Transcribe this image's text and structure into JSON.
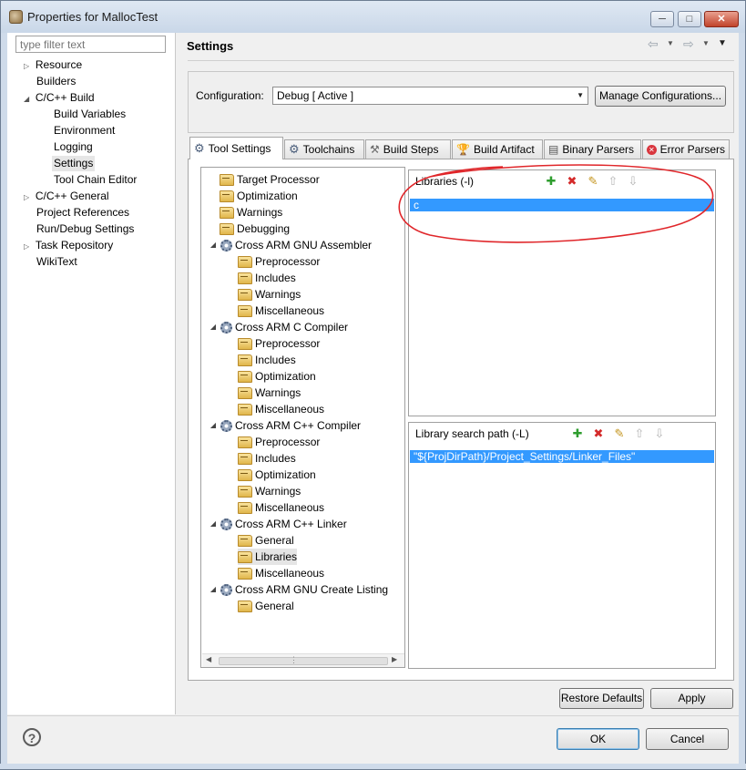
{
  "window": {
    "title": "Properties for MallocTest",
    "controls": {
      "minimize": "─",
      "maximize": "□",
      "close": "✕"
    }
  },
  "filter": {
    "placeholder": "type filter text"
  },
  "nav": {
    "items": [
      {
        "label": "Resource",
        "expandable": true,
        "expanded": false
      },
      {
        "label": "Builders"
      },
      {
        "label": "C/C++ Build",
        "expandable": true,
        "expanded": true
      },
      {
        "label": "Build Variables"
      },
      {
        "label": "Environment"
      },
      {
        "label": "Logging"
      },
      {
        "label": "Settings",
        "selected": true
      },
      {
        "label": "Tool Chain Editor"
      },
      {
        "label": "C/C++ General",
        "expandable": true,
        "expanded": false
      },
      {
        "label": "Project References"
      },
      {
        "label": "Run/Debug Settings"
      },
      {
        "label": "Task Repository",
        "expandable": true,
        "expanded": false
      },
      {
        "label": "WikiText"
      }
    ]
  },
  "header": {
    "title": "Settings"
  },
  "config": {
    "label": "Configuration:",
    "value": "Debug  [ Active ]",
    "manage_button": "Manage Configurations..."
  },
  "tabs": [
    "Tool Settings",
    "Toolchains",
    "Build Steps",
    "Build Artifact",
    "Binary Parsers",
    "Error Parsers"
  ],
  "tool_tree": [
    {
      "label": "Target Processor",
      "kind": "folder",
      "level": 0
    },
    {
      "label": "Optimization",
      "kind": "folder",
      "level": 0
    },
    {
      "label": "Warnings",
      "kind": "folder",
      "level": 0
    },
    {
      "label": "Debugging",
      "kind": "folder",
      "level": 0
    },
    {
      "label": "Cross ARM GNU Assembler",
      "kind": "tool",
      "level": 0
    },
    {
      "label": "Preprocessor",
      "kind": "folder",
      "level": 1
    },
    {
      "label": "Includes",
      "kind": "folder",
      "level": 1
    },
    {
      "label": "Warnings",
      "kind": "folder",
      "level": 1
    },
    {
      "label": "Miscellaneous",
      "kind": "folder",
      "level": 1
    },
    {
      "label": "Cross ARM C Compiler",
      "kind": "tool",
      "level": 0
    },
    {
      "label": "Preprocessor",
      "kind": "folder",
      "level": 1
    },
    {
      "label": "Includes",
      "kind": "folder",
      "level": 1
    },
    {
      "label": "Optimization",
      "kind": "folder",
      "level": 1
    },
    {
      "label": "Warnings",
      "kind": "folder",
      "level": 1
    },
    {
      "label": "Miscellaneous",
      "kind": "folder",
      "level": 1
    },
    {
      "label": "Cross ARM C++ Compiler",
      "kind": "tool",
      "level": 0
    },
    {
      "label": "Preprocessor",
      "kind": "folder",
      "level": 1
    },
    {
      "label": "Includes",
      "kind": "folder",
      "level": 1
    },
    {
      "label": "Optimization",
      "kind": "folder",
      "level": 1
    },
    {
      "label": "Warnings",
      "kind": "folder",
      "level": 1
    },
    {
      "label": "Miscellaneous",
      "kind": "folder",
      "level": 1
    },
    {
      "label": "Cross ARM C++ Linker",
      "kind": "tool",
      "level": 0
    },
    {
      "label": "General",
      "kind": "folder",
      "level": 1
    },
    {
      "label": "Libraries",
      "kind": "folder",
      "level": 1,
      "selected": true
    },
    {
      "label": "Miscellaneous",
      "kind": "folder",
      "level": 1
    },
    {
      "label": "Cross ARM GNU Create Listing",
      "kind": "tool",
      "level": 0
    },
    {
      "label": "General",
      "kind": "folder",
      "level": 1
    }
  ],
  "libraries": {
    "title": "Libraries (-l)",
    "items": [
      "c"
    ]
  },
  "library_paths": {
    "title": "Library search path (-L)",
    "items": [
      "\"${ProjDirPath}/Project_Settings/Linker_Files\""
    ]
  },
  "buttons": {
    "restore": "Restore Defaults",
    "apply": "Apply",
    "ok": "OK",
    "cancel": "Cancel",
    "help": "?"
  },
  "annotation_color": "#e0262a",
  "selection_color": "#3399ff"
}
